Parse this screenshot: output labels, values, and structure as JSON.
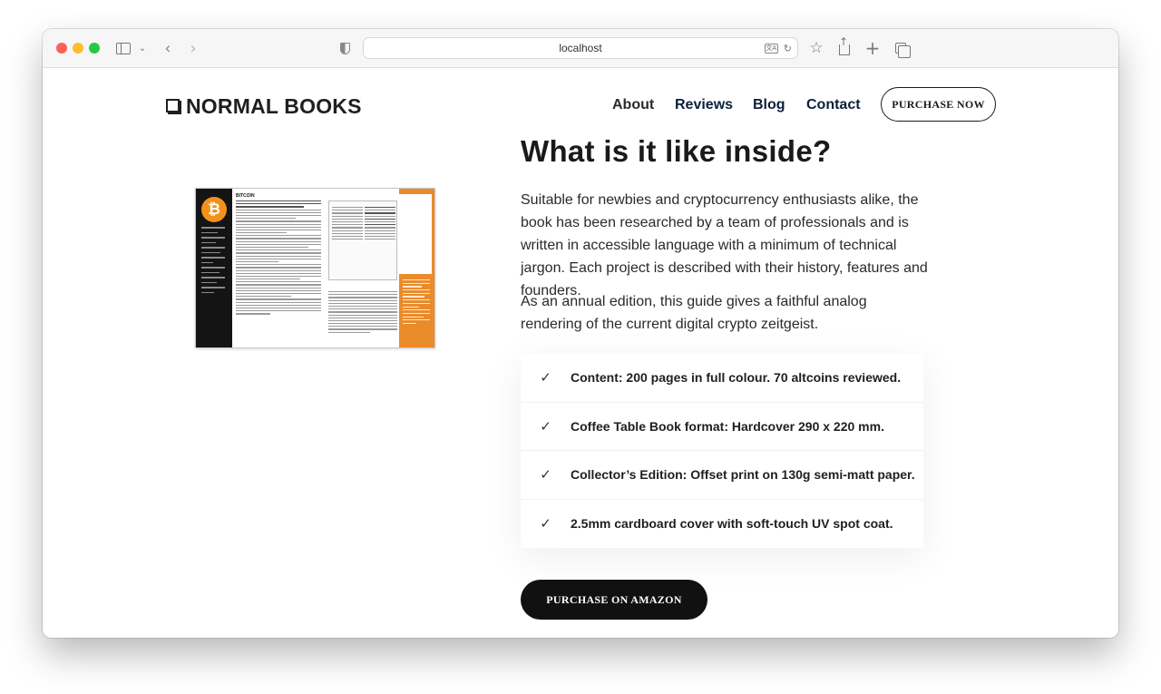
{
  "browser": {
    "url": "localhost"
  },
  "site": {
    "brand": "NORMAL BOOKS",
    "nav": {
      "about": "About",
      "reviews": "Reviews",
      "blog": "Blog",
      "contact": "Contact",
      "purchase_now": "PURCHASE NOW"
    }
  },
  "content": {
    "heading": "What is it like inside?",
    "paragraph_1": "Suitable for newbies and cryptocurrency enthusiasts alike, the book has been researched by a team of professionals and is written in accessible language with a minimum of technical jargon. Each project is described with their history, features and founders.",
    "paragraph_2": "As an annual edition, this guide gives a faithful analog rendering of the current digital crypto zeitgeist.",
    "features": [
      {
        "check": "✓",
        "text": "Content: 200 pages in full colour. 70 altcoins reviewed."
      },
      {
        "check": "✓",
        "text": "Coffee Table Book format: Hardcover 290 x 220 mm."
      },
      {
        "check": "✓",
        "text": "Collector’s Edition: Offset print on 130g semi-matt paper."
      },
      {
        "check": "✓",
        "text": "2.5mm cardboard cover with soft-touch UV spot coat."
      }
    ],
    "amazon_button": "PURCHASE ON AMAZON"
  },
  "book_preview": {
    "page_title": "BITCOIN",
    "logo_symbol": "₿"
  },
  "colors": {
    "accent_orange": "#ea8b2b",
    "button_dark": "#111111",
    "nav_link": "#0b1f3a"
  },
  "icons": {
    "sidebar": "sidebar-icon",
    "back": "chevron-left-icon",
    "forward": "chevron-right-icon",
    "privacy": "shield-icon",
    "translate": "translate-icon",
    "reload": "reload-icon",
    "bookmark": "star-icon",
    "share": "share-icon",
    "new_tab": "plus-icon",
    "tabs": "tabs-overview-icon"
  }
}
